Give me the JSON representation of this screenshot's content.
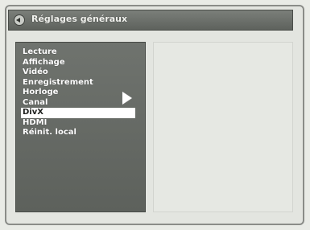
{
  "window": {
    "title": "Réglages généraux"
  },
  "menu": {
    "items": [
      {
        "label": "Lecture"
      },
      {
        "label": "Affichage"
      },
      {
        "label": "Vidéo"
      },
      {
        "label": "Enregistrement"
      },
      {
        "label": "Horloge"
      },
      {
        "label": "Canal"
      },
      {
        "label": "DivX"
      },
      {
        "label": "HDMI"
      },
      {
        "label": "Réinit. local"
      }
    ],
    "selected_index": 6
  },
  "icons": {
    "back": "back-icon",
    "submenu_arrow": "chevron-right-icon"
  }
}
